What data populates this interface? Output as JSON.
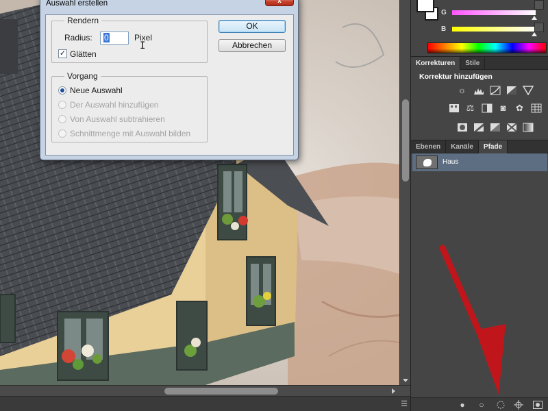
{
  "dialog": {
    "title": "Auswahl erstellen",
    "close_label": "x",
    "render": {
      "legend": "Rendern",
      "radius_label": "Radius:",
      "radius_value": "0",
      "radius_unit": "Pixel",
      "smooth_label": "Glätten",
      "smooth_checked": true
    },
    "operation": {
      "legend": "Vorgang",
      "options": [
        {
          "label": "Neue Auswahl",
          "checked": true,
          "enabled": true
        },
        {
          "label": "Der Auswahl hinzufügen",
          "checked": false,
          "enabled": false
        },
        {
          "label": "Von Auswahl subtrahieren",
          "checked": false,
          "enabled": false
        },
        {
          "label": "Schnittmenge mit Auswahl bilden",
          "checked": false,
          "enabled": false
        }
      ]
    },
    "ok_label": "OK",
    "cancel_label": "Abbrechen"
  },
  "color_panel": {
    "sliders": [
      {
        "label": "G",
        "gradient_start": "#ff55ff",
        "gradient_end": "#ffffff",
        "level": 0.98
      },
      {
        "label": "B",
        "gradient_start": "#ffff00",
        "gradient_end": "#ffffff",
        "level": 0.98
      }
    ]
  },
  "adjustments": {
    "tabs": [
      "Korrekturen",
      "Stile"
    ],
    "active_tab": 0,
    "title": "Korrektur hinzufügen"
  },
  "layers": {
    "tabs": [
      "Ebenen",
      "Kanäle",
      "Pfade"
    ],
    "active_tab": 2,
    "path_name": "Haus"
  },
  "colors": {
    "arrow": "#c0161b",
    "selected_row": "#5e6e82",
    "dialog_frame": "#c6d3e4"
  }
}
